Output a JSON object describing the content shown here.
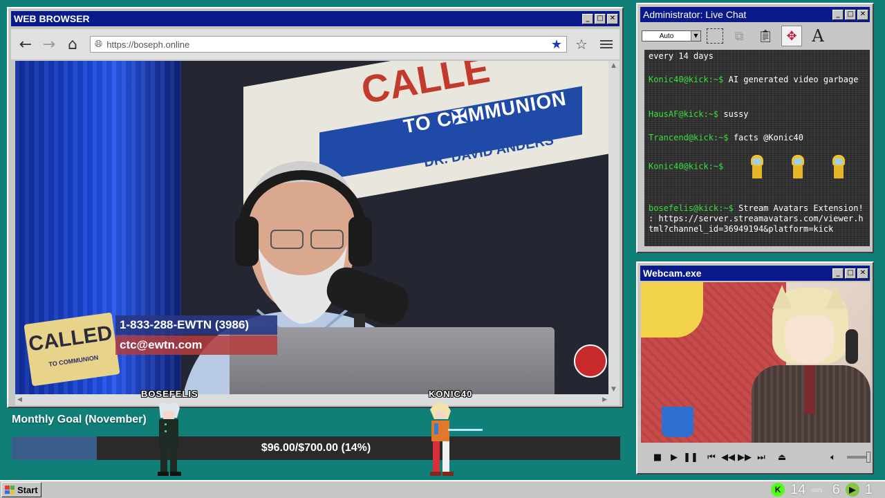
{
  "browser": {
    "title": "WEB BROWSER",
    "url": "https://boseph.online",
    "controls": {
      "minimize": "_",
      "maximize": "□",
      "close": "✕"
    }
  },
  "video": {
    "sign_big": "CALLE",
    "sign_main": "TO C✠MMUNION",
    "sign_sub": "DR. DAVID ANDERS",
    "logo_text": "CALLED",
    "logo_sub": "TO COMMUNION",
    "phone": "1-833-288-EWTN (3986)",
    "email": "ctc@ewtn.com"
  },
  "chat": {
    "title": "Administrator: Live Chat",
    "font_select": "Auto",
    "messages": [
      {
        "user": "",
        "text": "every 14 days"
      },
      {
        "user": "Konic40@kick:~$",
        "text": "AI generated video garbage"
      },
      {
        "user": "HausAF@kick:~$",
        "text": "sussy"
      },
      {
        "user": "Trancend@kick:~$",
        "text": "facts @Konic40"
      },
      {
        "user": "Konic40@kick:~$",
        "text": ""
      },
      {
        "user": "bosefelis@kick:~$",
        "text": "Stream Avatars Extension! : https://server.streamavatars.com/viewer.html?channel_id=36949194&platform=kick"
      }
    ]
  },
  "webcam": {
    "title": "Webcam.exe"
  },
  "goal": {
    "title": "Monthly Goal (November)",
    "text": "$96.00/$700.00 (14%)",
    "progress": 0.14
  },
  "avatars": [
    {
      "name": "BOSEFELIS"
    },
    {
      "name": "KONIC40"
    }
  ],
  "taskbar": {
    "start_label": "Start",
    "tray_kick_count": "14",
    "tray_cozy_label": "cozy",
    "tray_cozy_count": "6",
    "tray_rumble_count": "1"
  },
  "colors": {
    "desktop": "#0f7f77",
    "titlebar": "#0a1a8a",
    "chat_user": "#35e03a",
    "goal_fill": "#3b5d8c"
  }
}
